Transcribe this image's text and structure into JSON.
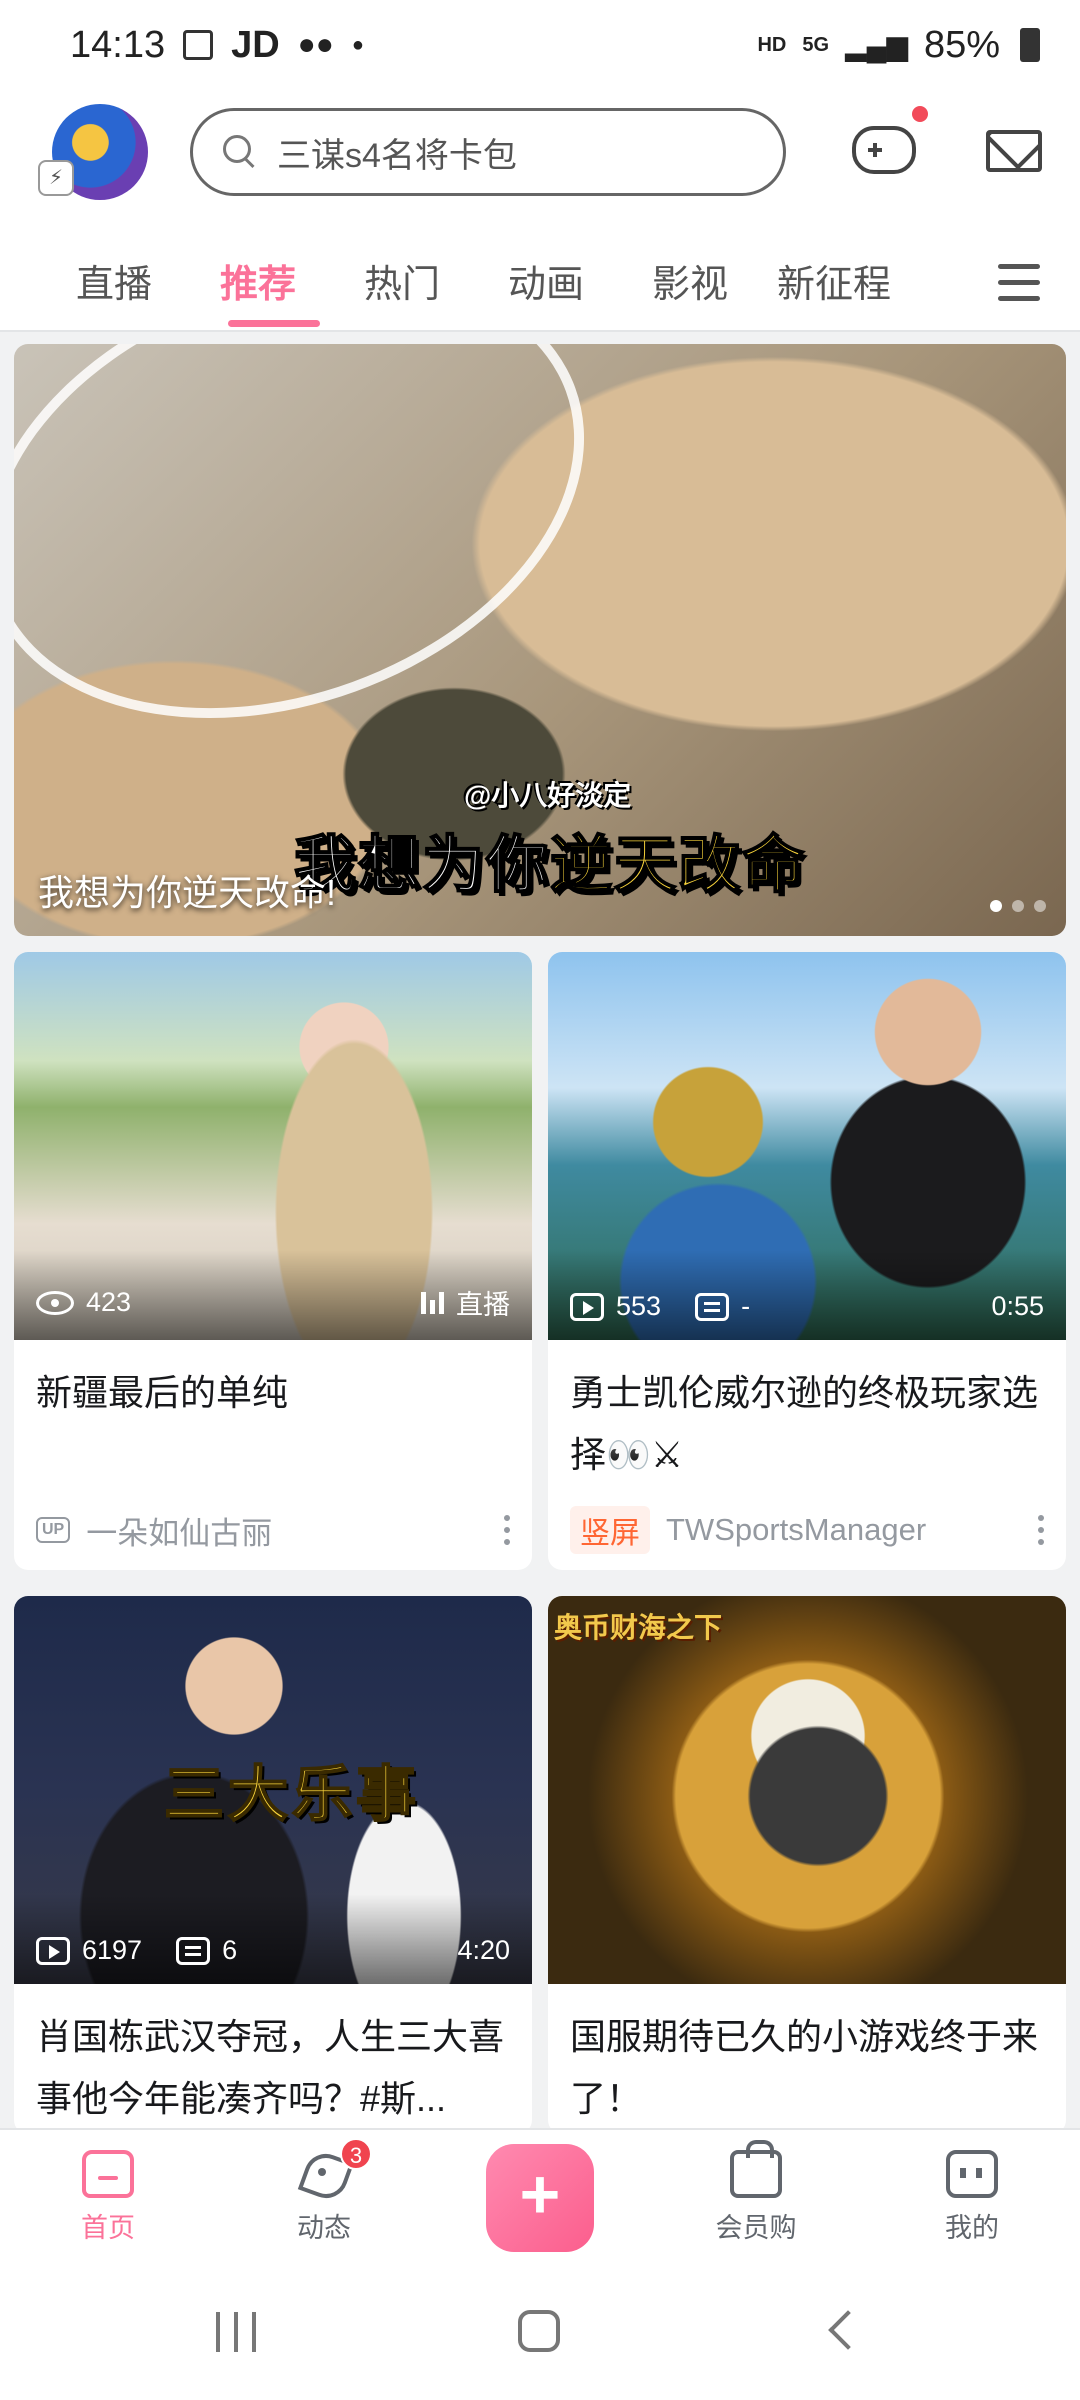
{
  "status_bar": {
    "time": "14:13",
    "carrier": "JD",
    "network_hd": "HD",
    "network_5g": "5G",
    "battery": "85%"
  },
  "header": {
    "search_placeholder": "三谋s4名将卡包",
    "icons": [
      "avatar",
      "search-icon",
      "game-controller-icon",
      "mail-icon"
    ]
  },
  "tabs": [
    {
      "label": "直播",
      "active": false
    },
    {
      "label": "推荐",
      "active": true
    },
    {
      "label": "热门",
      "active": false
    },
    {
      "label": "动画",
      "active": false
    },
    {
      "label": "影视",
      "active": false
    },
    {
      "label": "新征程",
      "active": false
    }
  ],
  "banner": {
    "watermark": "@小八好淡定",
    "headline_a": "我想为你",
    "headline_b": "逆天改命",
    "caption": "我想为你逆天改命!",
    "dots": 3,
    "active_dot": 1
  },
  "feed": [
    {
      "views": "423",
      "live_label": "直播",
      "title": "新疆最后的单纯",
      "author": "一朵如仙古丽",
      "up_badge": "UP"
    },
    {
      "plays": "553",
      "danmaku": "-",
      "duration": "0:55",
      "title": "勇士凯伦威尔逊的终极玩家选择👀⚔",
      "tag": "竖屏",
      "author": "TWSportsManager"
    },
    {
      "plays": "6197",
      "danmaku": "6",
      "duration": "4:20",
      "overlay_text": "三大乐事",
      "title": "肖国栋武汉夺冠，人生三大喜事他今年能凑齐吗？#斯..."
    },
    {
      "logo_text": "奥币财海之下",
      "title": "国服期待已久的小游戏终于来了！"
    }
  ],
  "bottom_nav": [
    {
      "label": "首页",
      "active": true
    },
    {
      "label": "动态",
      "active": false,
      "badge": "3"
    },
    {
      "label": "+",
      "active": false
    },
    {
      "label": "会员购",
      "active": false
    },
    {
      "label": "我的",
      "active": false
    }
  ],
  "colors": {
    "accent": "#fb7299",
    "badge": "#f0444f",
    "tag_orange": "#ff6633"
  }
}
